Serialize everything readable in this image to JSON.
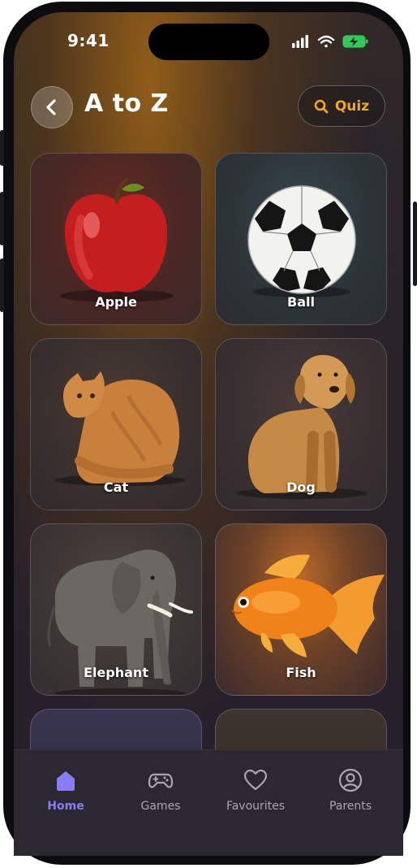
{
  "status": {
    "time": "9:41"
  },
  "header": {
    "title": "A to Z",
    "quiz_label": "Quiz"
  },
  "cards": [
    {
      "label": "Apple"
    },
    {
      "label": "Ball"
    },
    {
      "label": "Cat"
    },
    {
      "label": "Dog"
    },
    {
      "label": "Elephant"
    },
    {
      "label": "Fish"
    }
  ],
  "tabs": [
    {
      "label": "Home",
      "icon": "home-icon",
      "active": true
    },
    {
      "label": "Games",
      "icon": "gamepad-icon",
      "active": false
    },
    {
      "label": "Favourites",
      "icon": "heart-icon",
      "active": false
    },
    {
      "label": "Parents",
      "icon": "user-circle-icon",
      "active": false
    }
  ],
  "colors": {
    "accent": "#8b7cf6",
    "quiz": "#f5a623",
    "inactive": "#a9a6b0"
  }
}
